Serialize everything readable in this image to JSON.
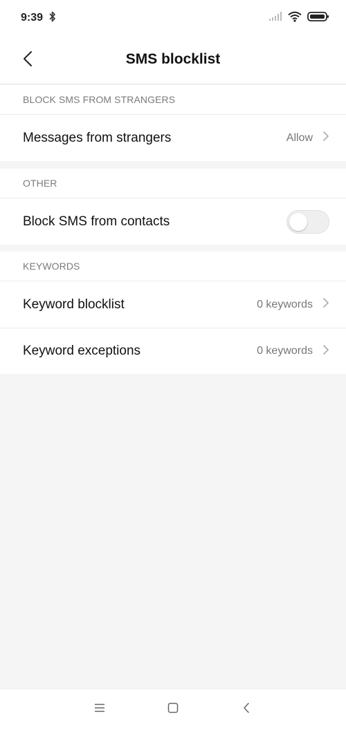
{
  "status_bar": {
    "time": "9:39",
    "icons": [
      "bluetooth-icon",
      "signal-icon",
      "wifi-icon",
      "battery-icon"
    ]
  },
  "header": {
    "title": "SMS blocklist",
    "back_icon": "back-arrow-icon"
  },
  "sections": {
    "strangers": {
      "header": "BLOCK SMS FROM STRANGERS",
      "rows": [
        {
          "label": "Messages from strangers",
          "value": "Allow"
        }
      ]
    },
    "other": {
      "header": "OTHER",
      "rows": [
        {
          "label": "Block SMS from contacts",
          "toggle_on": false
        }
      ]
    },
    "keywords": {
      "header": "KEYWORDS",
      "rows": [
        {
          "label": "Keyword blocklist",
          "value": "0 keywords"
        },
        {
          "label": "Keyword exceptions",
          "value": "0 keywords"
        }
      ]
    }
  },
  "nav_bar": {
    "icons": [
      "menu-icon",
      "home-icon",
      "back-icon"
    ]
  },
  "colors": {
    "background": "#f5f5f5",
    "card": "#ffffff",
    "section_header_text": "#7a7a7a",
    "value_text": "#777777"
  }
}
